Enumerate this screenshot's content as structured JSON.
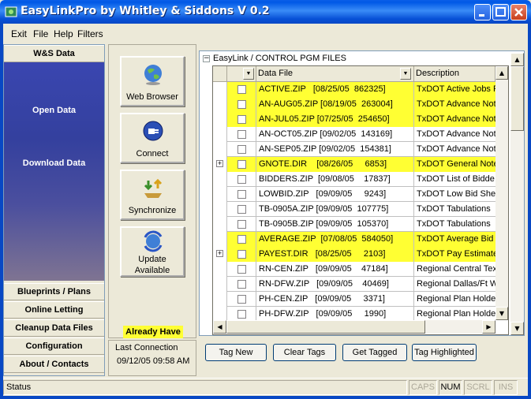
{
  "window": {
    "title": "EasyLinkPro by Whitley & Siddons V 0.2"
  },
  "menu": {
    "items": [
      {
        "label": "Exit",
        "accel": "x"
      },
      {
        "label": "File",
        "accel": "F"
      },
      {
        "label": "Help",
        "accel": "H"
      },
      {
        "label": "Filters",
        "accel": ""
      }
    ]
  },
  "nav": {
    "top_header": "W&S Data",
    "links": [
      "Open Data",
      "Download Data"
    ],
    "headers": [
      "Blueprints / Plans",
      "Online Letting",
      "Cleanup Data Files",
      "Configuration",
      "About / Contacts"
    ],
    "panel_gradient_top": "#3a46b0"
  },
  "actions": {
    "buttons": [
      {
        "label_1": "Web Browser",
        "label_2": "",
        "icon": "globe-icon"
      },
      {
        "label_1": "Connect",
        "label_2": "",
        "icon": "plug-icon"
      },
      {
        "label_1": "Synchronize",
        "label_2": "",
        "icon": "sync-arrows-icon"
      },
      {
        "label_1": "Update",
        "label_2": "Available",
        "icon": "refresh-globe-icon"
      }
    ],
    "already_have": "Already Have",
    "already_have_color": "#ffff33"
  },
  "connection": {
    "label": "Last Connection",
    "value": "09/12/05 09:58 AM"
  },
  "tree": {
    "title": "EasyLink / CONTROL PGM FILES",
    "expander": "−"
  },
  "grid": {
    "columns": [
      "",
      "",
      "Data File",
      "Description"
    ],
    "highlight_color": "#ffff33",
    "rows": [
      {
        "expand": false,
        "file": "ACTIVE.ZIP   [08/25/05  862325]",
        "desc": "TxDOT Active Jobs R",
        "highlight": true
      },
      {
        "expand": false,
        "file": "AN-AUG05.ZIP [08/19/05  263004]",
        "desc": "TxDOT Advance Note",
        "highlight": true
      },
      {
        "expand": false,
        "file": "AN-JUL05.ZIP [07/25/05  254650]",
        "desc": "TxDOT Advance Note",
        "highlight": true
      },
      {
        "expand": false,
        "file": "AN-OCT05.ZIP [09/02/05  143169]",
        "desc": "TxDOT Advance Note",
        "highlight": false
      },
      {
        "expand": false,
        "file": "AN-SEP05.ZIP [09/02/05  154381]",
        "desc": "TxDOT Advance Note",
        "highlight": false
      },
      {
        "expand": true,
        "file": "GNOTE.DIR    [08/26/05     6853]",
        "desc": "TxDOT General Note",
        "highlight": true
      },
      {
        "expand": false,
        "file": "BIDDERS.ZIP  [09/08/05    17837]",
        "desc": "TxDOT List of Bidde",
        "highlight": false
      },
      {
        "expand": false,
        "file": "LOWBID.ZIP   [09/09/05     9243]",
        "desc": "TxDOT Low Bid Shee",
        "highlight": false
      },
      {
        "expand": false,
        "file": "TB-0905A.ZIP [09/09/05  107775]",
        "desc": "TxDOT Tabulations",
        "highlight": false
      },
      {
        "expand": false,
        "file": "TB-0905B.ZIP [09/09/05  105370]",
        "desc": "TxDOT Tabulations",
        "highlight": false
      },
      {
        "expand": false,
        "file": "AVERAGE.ZIP  [07/08/05  584050]",
        "desc": "TxDOT Average Bid",
        "highlight": true
      },
      {
        "expand": true,
        "file": "PAYEST.DIR   [08/25/05     2103]",
        "desc": "TxDOT Pay Estimates",
        "highlight": true
      },
      {
        "expand": false,
        "file": "RN-CEN.ZIP   [09/09/05    47184]",
        "desc": "Regional Central Tex",
        "highlight": false
      },
      {
        "expand": false,
        "file": "RN-DFW.ZIP   [09/09/05    40469]",
        "desc": "Regional Dallas/Ft W",
        "highlight": false
      },
      {
        "expand": false,
        "file": "PH-CEN.ZIP   [09/09/05     3371]",
        "desc": "Regional Plan Holders",
        "highlight": false
      },
      {
        "expand": false,
        "file": "PH-DFW.ZIP   [09/09/05     1990]",
        "desc": "Regional Plan Holders",
        "highlight": false
      }
    ]
  },
  "bottom_buttons": [
    "Tag New",
    "Clear Tags",
    "Get Tagged",
    "Tag Highlighted"
  ],
  "status": {
    "text": "Status",
    "indicators": [
      {
        "label": "CAPS",
        "active": false
      },
      {
        "label": "NUM",
        "active": true
      },
      {
        "label": "SCRL",
        "active": false
      },
      {
        "label": "INS",
        "active": false
      }
    ]
  }
}
